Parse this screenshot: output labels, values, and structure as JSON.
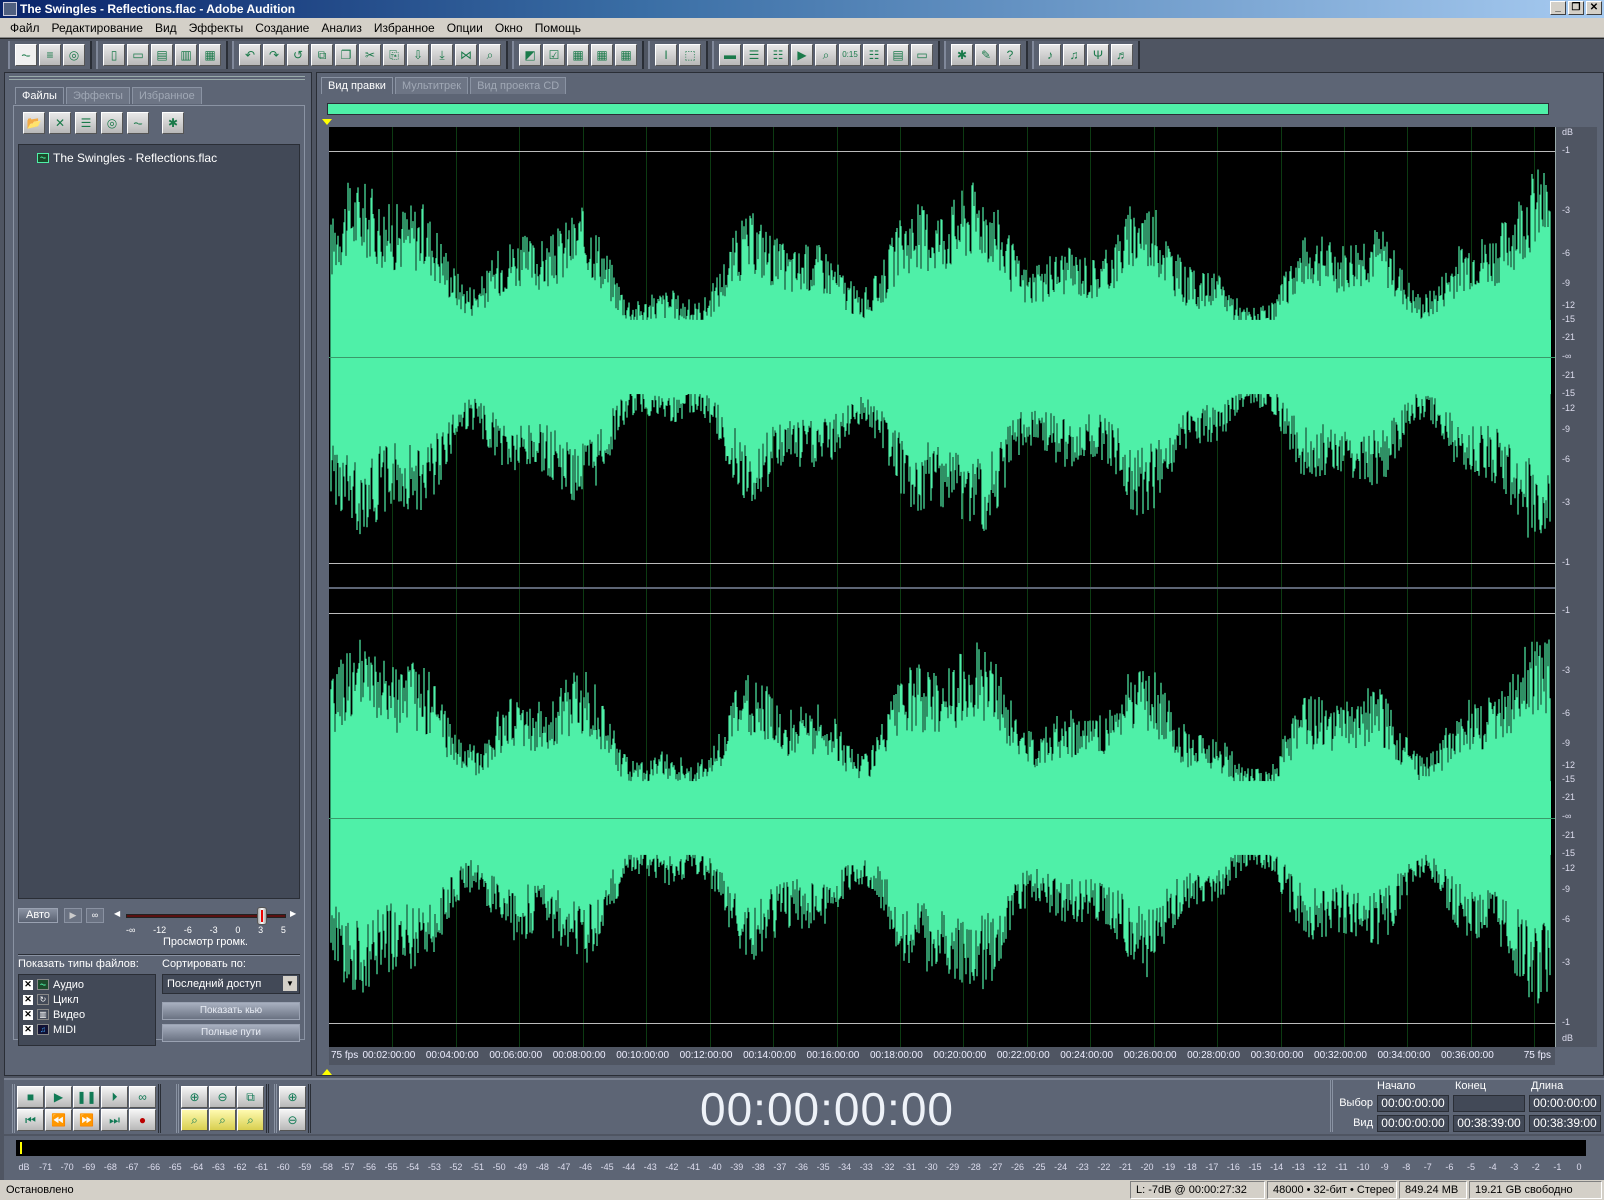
{
  "window": {
    "title": "The Swingles - Reflections.flac - Adobe Audition",
    "controls": [
      "_",
      "❐",
      "✕"
    ]
  },
  "menu": [
    "Файл",
    "Редактирование",
    "Вид",
    "Эффекты",
    "Создание",
    "Анализ",
    "Избранное",
    "Опции",
    "Окно",
    "Помощь"
  ],
  "toolbar": {
    "groups": [
      [
        {
          "icon": "edit-view-icon",
          "glyph": "⏦"
        },
        {
          "icon": "multitrack-view-icon",
          "glyph": "≡"
        },
        {
          "icon": "cd-view-icon",
          "glyph": "◎"
        }
      ],
      [
        {
          "icon": "new-file-icon",
          "glyph": "▯"
        },
        {
          "icon": "open-folder-icon",
          "glyph": "▭"
        },
        {
          "icon": "save-icon",
          "glyph": "▤"
        },
        {
          "icon": "save-as-icon",
          "glyph": "▥"
        },
        {
          "icon": "save-all-icon",
          "glyph": "▦"
        }
      ],
      [
        {
          "icon": "undo-icon",
          "glyph": "↶"
        },
        {
          "icon": "redo-icon",
          "glyph": "↷"
        },
        {
          "icon": "repeat-last-icon",
          "glyph": "↺"
        },
        {
          "icon": "copy-to-new-icon",
          "glyph": "⧉"
        },
        {
          "icon": "copy-icon",
          "glyph": "❐"
        },
        {
          "icon": "cut-icon",
          "glyph": "✂"
        },
        {
          "icon": "paste-icon",
          "glyph": "⎘"
        },
        {
          "icon": "paste-to-new-icon",
          "glyph": "⇩"
        },
        {
          "icon": "mix-paste-icon",
          "glyph": "⤓"
        },
        {
          "icon": "crop-icon",
          "glyph": "⋈"
        },
        {
          "icon": "zoom-to-selection-icon",
          "glyph": "⌕"
        }
      ],
      [
        {
          "icon": "envelope-icon",
          "glyph": "◩"
        },
        {
          "icon": "checkbox-icon",
          "glyph": "☑"
        },
        {
          "icon": "waveform-grid-icon",
          "glyph": "▦"
        },
        {
          "icon": "spectral-icon",
          "glyph": "▦"
        },
        {
          "icon": "stereo-icon",
          "glyph": "▦"
        }
      ],
      [
        {
          "icon": "time-select-icon",
          "glyph": "I"
        },
        {
          "icon": "marquee-select-icon",
          "glyph": "⬚"
        }
      ],
      [
        {
          "icon": "window-icon",
          "glyph": "▬"
        },
        {
          "icon": "cue-list-icon",
          "glyph": "☰"
        },
        {
          "icon": "playlist-icon",
          "glyph": "☷"
        },
        {
          "icon": "transport-icon",
          "glyph": "▶"
        },
        {
          "icon": "zoom-window-icon",
          "glyph": "⌕"
        },
        {
          "icon": "time-window-icon",
          "glyph": "0:15"
        },
        {
          "icon": "selection-window-icon",
          "glyph": "☷"
        },
        {
          "icon": "level-meter-icon",
          "glyph": "▤"
        },
        {
          "icon": "blank-window-icon",
          "glyph": "▭"
        }
      ],
      [
        {
          "icon": "effects-settings-icon",
          "glyph": "✱"
        },
        {
          "icon": "script-icon",
          "glyph": "✎"
        },
        {
          "icon": "help-icon",
          "glyph": "?"
        }
      ],
      [
        {
          "icon": "pitch-icon",
          "glyph": "♪"
        },
        {
          "icon": "stretch-icon",
          "glyph": "♫"
        },
        {
          "icon": "tuning-fork-icon",
          "glyph": "Ψ"
        },
        {
          "icon": "tempo-icon",
          "glyph": "♬"
        }
      ]
    ]
  },
  "left_panel": {
    "tabs": [
      {
        "label": "Файлы",
        "active": true
      },
      {
        "label": "Эффекты",
        "active": false
      },
      {
        "label": "Избранное",
        "active": false
      }
    ],
    "file_tools": [
      {
        "icon": "import-file-icon",
        "glyph": "📂"
      },
      {
        "icon": "close-file-icon",
        "glyph": "✕"
      },
      {
        "icon": "insert-multitrack-icon",
        "glyph": "☰"
      },
      {
        "icon": "insert-cd-icon",
        "glyph": "◎"
      },
      {
        "icon": "edit-file-icon",
        "glyph": "⏦"
      },
      {
        "icon": "autoplay-settings-icon",
        "glyph": "✱"
      }
    ],
    "files": [
      {
        "name": "The Swingles - Reflections.flac",
        "icon": "audio-file-icon"
      }
    ],
    "preview": {
      "auto_label": "Авто",
      "play_glyph": "▶",
      "loop_glyph": "∞",
      "volume_ticks": [
        "-∞",
        "-12",
        "-6",
        "-3",
        "0",
        "3",
        "5"
      ],
      "volume_db": 0,
      "volume_range_db": [
        -40,
        6
      ],
      "label": "Просмотр громк."
    },
    "file_types_label": "Показать типы файлов:",
    "file_types": [
      {
        "label": "Аудио",
        "checked": true,
        "icon": "audio-type-icon",
        "glyph": "⏦"
      },
      {
        "label": "Цикл",
        "checked": true,
        "icon": "loop-type-icon",
        "glyph": "↻"
      },
      {
        "label": "Видео",
        "checked": true,
        "icon": "video-type-icon",
        "glyph": "▥"
      },
      {
        "label": "MIDI",
        "checked": true,
        "icon": "midi-type-icon",
        "glyph": "♫"
      }
    ],
    "sort_label": "Сортировать по:",
    "sort_value": "Последний доступ",
    "show_cue_label": "Показать кью",
    "full_paths_label": "Полные пути"
  },
  "main": {
    "tabs": [
      {
        "label": "Вид правки",
        "active": true
      },
      {
        "label": "Мультитрек",
        "active": false
      },
      {
        "label": "Вид проекта CD",
        "active": false
      }
    ],
    "db_labels": [
      "dB",
      "-1",
      "-3",
      "-6",
      "-9",
      "-12",
      "-15",
      "-21",
      "-∞",
      "-21",
      "-15",
      "-12",
      "-9",
      "-6",
      "-3",
      "-1"
    ],
    "db_labels_bottom": [
      "-1",
      "-3",
      "-6",
      "-9",
      "-12",
      "-15",
      "-21",
      "-∞",
      "-21",
      "-15",
      "-12",
      "-9",
      "-6",
      "-3",
      "-1",
      "dB"
    ],
    "time_ruler": {
      "left": "75 fps",
      "right": "75 fps",
      "labels": [
        "00:02:00:00",
        "00:04:00:00",
        "00:06:00:00",
        "00:08:00:00",
        "00:10:00:00",
        "00:12:00:00",
        "00:14:00:00",
        "00:16:00:00",
        "00:18:00:00",
        "00:20:00:00",
        "00:22:00:00",
        "00:24:00:00",
        "00:26:00:00",
        "00:28:00:00",
        "00:30:00:00",
        "00:32:00:00",
        "00:34:00:00",
        "00:36:00:00"
      ]
    },
    "wave_color": "#4ff0a8",
    "total_minutes": 38.65
  },
  "transport": {
    "row1": [
      {
        "icon": "stop-icon",
        "glyph": "■"
      },
      {
        "icon": "play-icon",
        "glyph": "▶"
      },
      {
        "icon": "pause-icon",
        "glyph": "❚❚"
      },
      {
        "icon": "play-to-end-icon",
        "glyph": "⏵"
      },
      {
        "icon": "loop-icon",
        "glyph": "∞"
      }
    ],
    "row2": [
      {
        "icon": "go-to-start-icon",
        "glyph": "⏮"
      },
      {
        "icon": "rewind-icon",
        "glyph": "⏪"
      },
      {
        "icon": "fast-forward-icon",
        "glyph": "⏩"
      },
      {
        "icon": "go-to-end-icon",
        "glyph": "⏭"
      },
      {
        "icon": "record-icon",
        "glyph": "●"
      }
    ],
    "zoom_row1": [
      {
        "icon": "zoom-in-icon",
        "glyph": "⊕"
      },
      {
        "icon": "zoom-out-icon",
        "glyph": "⊖"
      },
      {
        "icon": "zoom-full-icon",
        "glyph": "⧉"
      }
    ],
    "zoom_row2": [
      {
        "icon": "zoom-selection-icon",
        "glyph": "⌕"
      },
      {
        "icon": "zoom-left-icon",
        "glyph": "⌕"
      },
      {
        "icon": "zoom-right-icon",
        "glyph": "⌕"
      }
    ],
    "vzoom": [
      {
        "icon": "vertical-zoom-in-icon",
        "glyph": "⊕"
      },
      {
        "icon": "vertical-zoom-out-icon",
        "glyph": "⊖"
      }
    ]
  },
  "time_display": "00:00:00:00",
  "selection": {
    "headers": [
      "Начало",
      "Конец",
      "Длина"
    ],
    "sel_label": "Выбор",
    "view_label": "Вид",
    "sel_start": "00:00:00:00",
    "sel_end": "",
    "sel_length": "00:00:00:00",
    "view_start": "00:00:00:00",
    "view_end": "00:38:39:00",
    "view_length": "00:38:39:00"
  },
  "level_meter": {
    "labels": [
      "dB",
      "-71",
      "-70",
      "-69",
      "-68",
      "-67",
      "-66",
      "-65",
      "-64",
      "-63",
      "-62",
      "-61",
      "-60",
      "-59",
      "-58",
      "-57",
      "-56",
      "-55",
      "-54",
      "-53",
      "-52",
      "-51",
      "-50",
      "-49",
      "-48",
      "-47",
      "-46",
      "-45",
      "-44",
      "-43",
      "-42",
      "-41",
      "-40",
      "-39",
      "-38",
      "-37",
      "-36",
      "-35",
      "-34",
      "-33",
      "-32",
      "-31",
      "-30",
      "-29",
      "-28",
      "-27",
      "-26",
      "-25",
      "-24",
      "-23",
      "-22",
      "-21",
      "-20",
      "-19",
      "-18",
      "-17",
      "-16",
      "-15",
      "-14",
      "-13",
      "-12",
      "-11",
      "-10",
      "-9",
      "-8",
      "-7",
      "-6",
      "-5",
      "-4",
      "-3",
      "-2",
      "-1",
      "0"
    ]
  },
  "status": {
    "state": "Остановлено",
    "cursor": "L: -7dB @ 00:00:27:32",
    "format": "48000 • 32-бит • Стерео",
    "size": "849.24 MB",
    "free": "19.21 GB свободно"
  }
}
